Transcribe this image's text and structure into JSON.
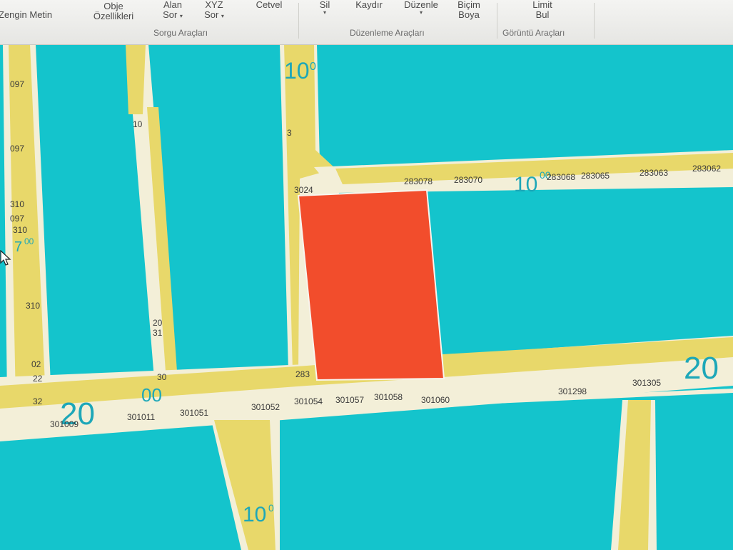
{
  "ribbon": {
    "buttons": {
      "rich_text": "Zengin Metin",
      "object_props_1": "Obje",
      "object_props_2": "Özellikleri",
      "area_1": "Alan",
      "area_2": "Sor",
      "xyz_1": "XYZ",
      "xyz_2": "Sor",
      "ruler": "Cetvel",
      "delete": "Sil",
      "move": "Kaydır",
      "edit": "Düzenle",
      "paint_1": "Biçim",
      "paint_2": "Boya",
      "limit_1": "Limit",
      "limit_2": "Bul"
    },
    "groups": {
      "query": "Sorgu Araçları",
      "edit": "Düzenleme Araçları",
      "view": "Görüntü Araçları"
    }
  },
  "map": {
    "colors": {
      "background": "#14c4cc",
      "road": "#e8d86a",
      "road_edge": "#f3efd8",
      "parcel": "#f24d2c",
      "label": "#1da7b8",
      "parcel_number": "#3a3a3a"
    },
    "road_widths": {
      "w20_left": "20",
      "w20_left_sup": "00",
      "w20_right": "20",
      "w10_top": "10",
      "w10_top_sup": "0",
      "w10_right": "10",
      "w10_right_sup": "00",
      "w10_bottom": "10",
      "w10_bottom_sup": "0",
      "w7_left": "7",
      "w7_left_sup": "00"
    },
    "parcel_numbers": {
      "top_row": [
        "283078",
        "283070",
        "283068",
        "283065",
        "283063",
        "283062"
      ],
      "parcel_tl": "3024",
      "parcel_bl": "283",
      "bottom_row": [
        "301009",
        "301011",
        "301051",
        "301052",
        "301054",
        "301057",
        "301058",
        "301060",
        "301298",
        "301305"
      ],
      "left_col": [
        "097",
        "097",
        "310",
        "097",
        "310",
        "310",
        "02",
        "22",
        "32"
      ],
      "left_road": [
        "10",
        "20",
        "31",
        "30"
      ],
      "top_road": [
        "3"
      ]
    }
  }
}
